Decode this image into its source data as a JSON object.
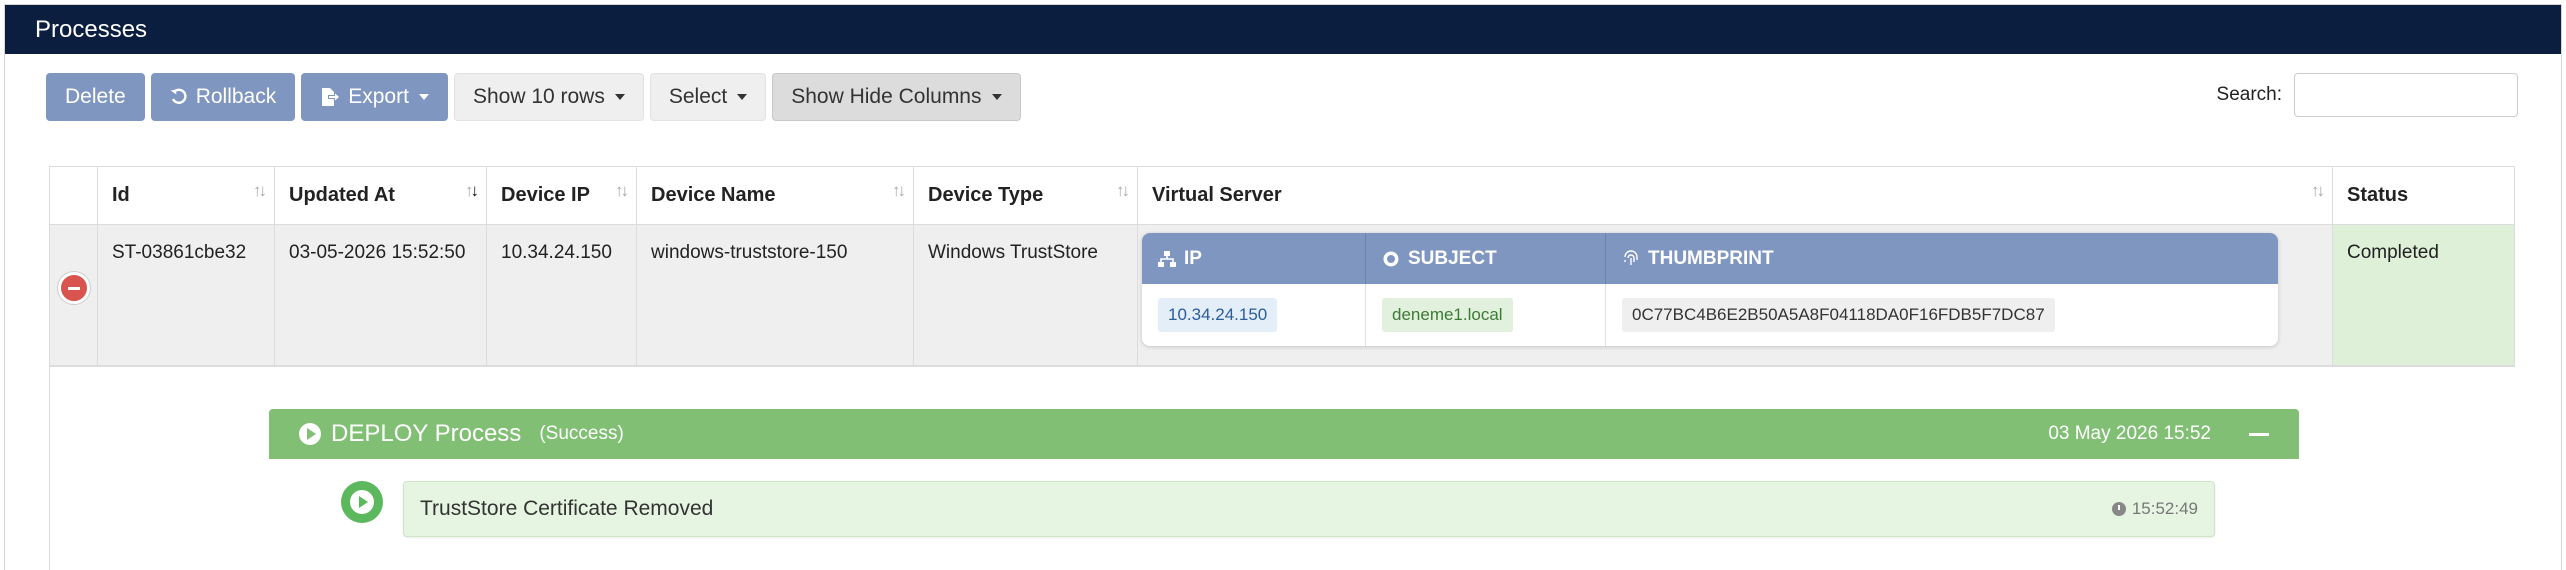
{
  "panel": {
    "title": "Processes"
  },
  "toolbar": {
    "delete_label": "Delete",
    "rollback_label": "Rollback",
    "export_label": "Export",
    "show_rows_label": "Show 10 rows",
    "select_label": "Select",
    "show_hide_columns_label": "Show Hide Columns"
  },
  "search": {
    "label": "Search:",
    "value": "",
    "placeholder": ""
  },
  "table": {
    "columns": [
      "Id",
      "Updated At",
      "Device IP",
      "Device Name",
      "Device Type",
      "Virtual Server",
      "Status"
    ],
    "rows": [
      {
        "id": "ST-03861cbe32",
        "updated_at": "03-05-2026 15:52:50",
        "device_ip": "10.34.24.150",
        "device_name": "windows-truststore-150",
        "device_type": "Windows TrustStore",
        "virtual_server": {
          "headers": {
            "ip": "IP",
            "subject": "SUBJECT",
            "thumbprint": "THUMBPRINT"
          },
          "ip": "10.34.24.150",
          "subject": "deneme1.local",
          "thumbprint": "0C77BC4B6E2B50A5A8F04118DA0F16FDB5F7DC87"
        },
        "status": "Completed"
      }
    ]
  },
  "process": {
    "title": "DEPLOY Process",
    "status": "(Success)",
    "date": "03 May 2026 15:52",
    "events": [
      {
        "text": "TrustStore Certificate Removed",
        "time": "15:52:49"
      }
    ]
  },
  "colors": {
    "header_bg": "#0b1e3f",
    "primary_button": "#7f96c0",
    "success_bar": "#81c074",
    "status_cell": "#dff0d8",
    "danger": "#d9534f"
  }
}
